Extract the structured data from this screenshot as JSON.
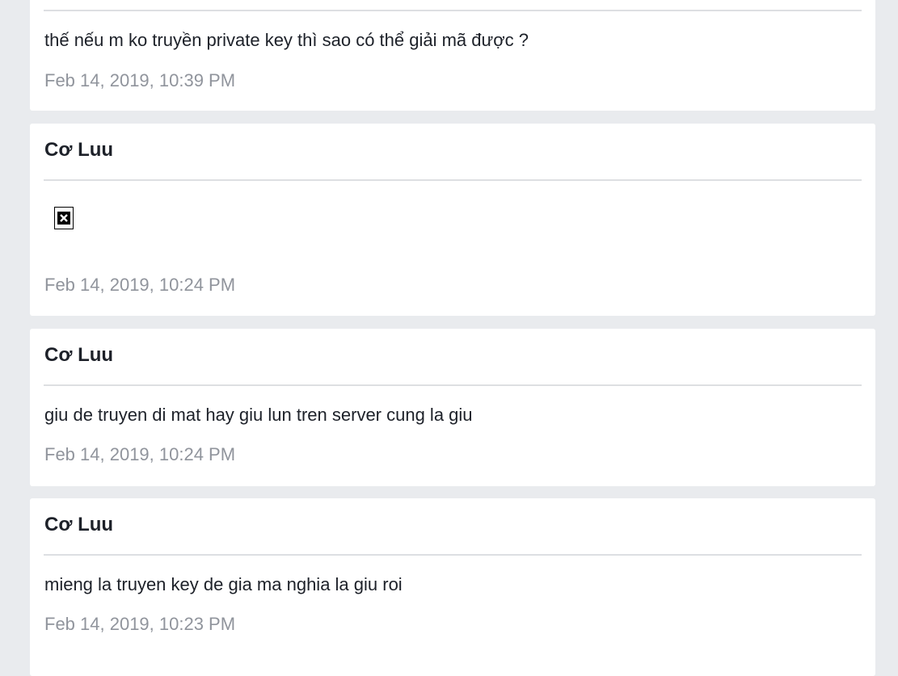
{
  "messages": [
    {
      "sender": "",
      "text": "thế nếu m ko truyền private key thì sao có thể giải mã được ?",
      "time": "Feb 14, 2019, 10:39 PM"
    },
    {
      "sender": "Cơ Luu",
      "text": "",
      "attachment_icon": "broken-image-icon",
      "time": "Feb 14, 2019, 10:24 PM"
    },
    {
      "sender": "Cơ Luu",
      "text": "giu de truyen di mat hay giu lun tren server cung la giu",
      "time": "Feb 14, 2019, 10:24 PM"
    },
    {
      "sender": "Cơ Luu",
      "text": "mieng la truyen key de gia ma nghia la giu roi",
      "time": "Feb 14, 2019, 10:23 PM"
    }
  ]
}
